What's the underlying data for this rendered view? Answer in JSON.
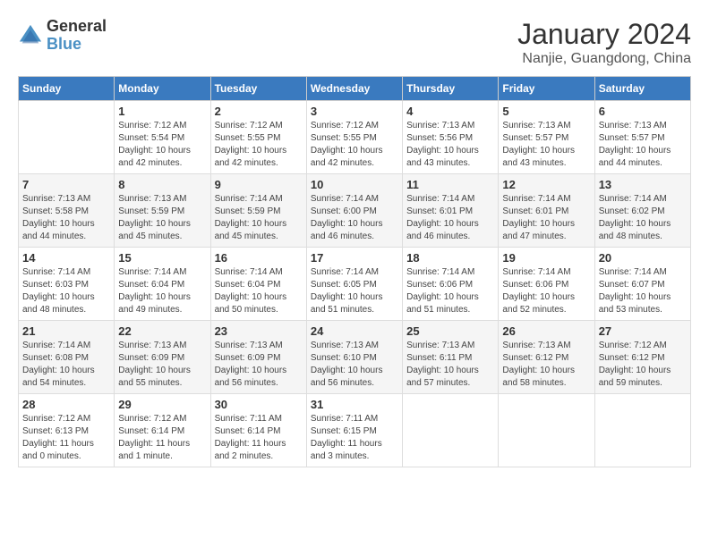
{
  "logo": {
    "line1": "General",
    "line2": "Blue"
  },
  "title": "January 2024",
  "location": "Nanjie, Guangdong, China",
  "weekdays": [
    "Sunday",
    "Monday",
    "Tuesday",
    "Wednesday",
    "Thursday",
    "Friday",
    "Saturday"
  ],
  "weeks": [
    [
      {
        "day": "",
        "sunrise": "",
        "sunset": "",
        "daylight": ""
      },
      {
        "day": "1",
        "sunrise": "Sunrise: 7:12 AM",
        "sunset": "Sunset: 5:54 PM",
        "daylight": "Daylight: 10 hours and 42 minutes."
      },
      {
        "day": "2",
        "sunrise": "Sunrise: 7:12 AM",
        "sunset": "Sunset: 5:55 PM",
        "daylight": "Daylight: 10 hours and 42 minutes."
      },
      {
        "day": "3",
        "sunrise": "Sunrise: 7:12 AM",
        "sunset": "Sunset: 5:55 PM",
        "daylight": "Daylight: 10 hours and 42 minutes."
      },
      {
        "day": "4",
        "sunrise": "Sunrise: 7:13 AM",
        "sunset": "Sunset: 5:56 PM",
        "daylight": "Daylight: 10 hours and 43 minutes."
      },
      {
        "day": "5",
        "sunrise": "Sunrise: 7:13 AM",
        "sunset": "Sunset: 5:57 PM",
        "daylight": "Daylight: 10 hours and 43 minutes."
      },
      {
        "day": "6",
        "sunrise": "Sunrise: 7:13 AM",
        "sunset": "Sunset: 5:57 PM",
        "daylight": "Daylight: 10 hours and 44 minutes."
      }
    ],
    [
      {
        "day": "7",
        "sunrise": "Sunrise: 7:13 AM",
        "sunset": "Sunset: 5:58 PM",
        "daylight": "Daylight: 10 hours and 44 minutes."
      },
      {
        "day": "8",
        "sunrise": "Sunrise: 7:13 AM",
        "sunset": "Sunset: 5:59 PM",
        "daylight": "Daylight: 10 hours and 45 minutes."
      },
      {
        "day": "9",
        "sunrise": "Sunrise: 7:14 AM",
        "sunset": "Sunset: 5:59 PM",
        "daylight": "Daylight: 10 hours and 45 minutes."
      },
      {
        "day": "10",
        "sunrise": "Sunrise: 7:14 AM",
        "sunset": "Sunset: 6:00 PM",
        "daylight": "Daylight: 10 hours and 46 minutes."
      },
      {
        "day": "11",
        "sunrise": "Sunrise: 7:14 AM",
        "sunset": "Sunset: 6:01 PM",
        "daylight": "Daylight: 10 hours and 46 minutes."
      },
      {
        "day": "12",
        "sunrise": "Sunrise: 7:14 AM",
        "sunset": "Sunset: 6:01 PM",
        "daylight": "Daylight: 10 hours and 47 minutes."
      },
      {
        "day": "13",
        "sunrise": "Sunrise: 7:14 AM",
        "sunset": "Sunset: 6:02 PM",
        "daylight": "Daylight: 10 hours and 48 minutes."
      }
    ],
    [
      {
        "day": "14",
        "sunrise": "Sunrise: 7:14 AM",
        "sunset": "Sunset: 6:03 PM",
        "daylight": "Daylight: 10 hours and 48 minutes."
      },
      {
        "day": "15",
        "sunrise": "Sunrise: 7:14 AM",
        "sunset": "Sunset: 6:04 PM",
        "daylight": "Daylight: 10 hours and 49 minutes."
      },
      {
        "day": "16",
        "sunrise": "Sunrise: 7:14 AM",
        "sunset": "Sunset: 6:04 PM",
        "daylight": "Daylight: 10 hours and 50 minutes."
      },
      {
        "day": "17",
        "sunrise": "Sunrise: 7:14 AM",
        "sunset": "Sunset: 6:05 PM",
        "daylight": "Daylight: 10 hours and 51 minutes."
      },
      {
        "day": "18",
        "sunrise": "Sunrise: 7:14 AM",
        "sunset": "Sunset: 6:06 PM",
        "daylight": "Daylight: 10 hours and 51 minutes."
      },
      {
        "day": "19",
        "sunrise": "Sunrise: 7:14 AM",
        "sunset": "Sunset: 6:06 PM",
        "daylight": "Daylight: 10 hours and 52 minutes."
      },
      {
        "day": "20",
        "sunrise": "Sunrise: 7:14 AM",
        "sunset": "Sunset: 6:07 PM",
        "daylight": "Daylight: 10 hours and 53 minutes."
      }
    ],
    [
      {
        "day": "21",
        "sunrise": "Sunrise: 7:14 AM",
        "sunset": "Sunset: 6:08 PM",
        "daylight": "Daylight: 10 hours and 54 minutes."
      },
      {
        "day": "22",
        "sunrise": "Sunrise: 7:13 AM",
        "sunset": "Sunset: 6:09 PM",
        "daylight": "Daylight: 10 hours and 55 minutes."
      },
      {
        "day": "23",
        "sunrise": "Sunrise: 7:13 AM",
        "sunset": "Sunset: 6:09 PM",
        "daylight": "Daylight: 10 hours and 56 minutes."
      },
      {
        "day": "24",
        "sunrise": "Sunrise: 7:13 AM",
        "sunset": "Sunset: 6:10 PM",
        "daylight": "Daylight: 10 hours and 56 minutes."
      },
      {
        "day": "25",
        "sunrise": "Sunrise: 7:13 AM",
        "sunset": "Sunset: 6:11 PM",
        "daylight": "Daylight: 10 hours and 57 minutes."
      },
      {
        "day": "26",
        "sunrise": "Sunrise: 7:13 AM",
        "sunset": "Sunset: 6:12 PM",
        "daylight": "Daylight: 10 hours and 58 minutes."
      },
      {
        "day": "27",
        "sunrise": "Sunrise: 7:12 AM",
        "sunset": "Sunset: 6:12 PM",
        "daylight": "Daylight: 10 hours and 59 minutes."
      }
    ],
    [
      {
        "day": "28",
        "sunrise": "Sunrise: 7:12 AM",
        "sunset": "Sunset: 6:13 PM",
        "daylight": "Daylight: 11 hours and 0 minutes."
      },
      {
        "day": "29",
        "sunrise": "Sunrise: 7:12 AM",
        "sunset": "Sunset: 6:14 PM",
        "daylight": "Daylight: 11 hours and 1 minute."
      },
      {
        "day": "30",
        "sunrise": "Sunrise: 7:11 AM",
        "sunset": "Sunset: 6:14 PM",
        "daylight": "Daylight: 11 hours and 2 minutes."
      },
      {
        "day": "31",
        "sunrise": "Sunrise: 7:11 AM",
        "sunset": "Sunset: 6:15 PM",
        "daylight": "Daylight: 11 hours and 3 minutes."
      },
      {
        "day": "",
        "sunrise": "",
        "sunset": "",
        "daylight": ""
      },
      {
        "day": "",
        "sunrise": "",
        "sunset": "",
        "daylight": ""
      },
      {
        "day": "",
        "sunrise": "",
        "sunset": "",
        "daylight": ""
      }
    ]
  ]
}
